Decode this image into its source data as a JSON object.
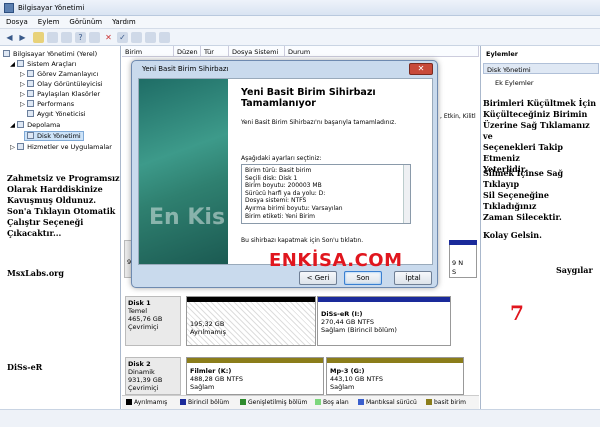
{
  "window": {
    "title": "Bilgisayar Yönetimi"
  },
  "menu": [
    "Dosya",
    "Eylem",
    "Görünüm",
    "Yardım"
  ],
  "tree": {
    "root": "Bilgisayar Yönetimi (Yerel)",
    "items": [
      "Sistem Araçları",
      "Görev Zamanlayıcı",
      "Olay Görüntüleyicisi",
      "Paylaşılan Klasörler",
      "Performans",
      "Aygıt Yöneticisi",
      "Depolama",
      "Disk Yönetimi",
      "Hizmetler ve Uygulamalar"
    ]
  },
  "columns": [
    "Birim",
    "Düzen",
    "Tür",
    "Dosya Sistemi",
    "Durum"
  ],
  "actions": {
    "header": "Eylemler",
    "selected": "Disk Yönetimi",
    "more": "Ek Eylemler"
  },
  "wizard": {
    "window_title": "Yeni Basit Birim Sihirbazı",
    "heading_line1": "Yeni Basit Birim Sihirbazı",
    "heading_line2": "Tamamlanıyor",
    "success_text": "Yeni Basit Birim Sihirbazı'nı başarıyla tamamladınız.",
    "settings_label": "Aşağıdaki ayarları seçtiniz:",
    "settings": [
      "Birim türü: Basit birim",
      "Seçili disk: Disk 1",
      "Birim boyutu: 200003 MB",
      "Sürücü harfi ya da yolu: D:",
      "Dosya sistemi: NTFS",
      "Ayırma birimi boyutu: Varsayılan",
      "Birim etiketi: Yeni Birim"
    ],
    "close_text": "Bu sihirbazı kapatmak için Son'u tıklatın.",
    "btn_back": "< Geri",
    "btn_finish": "Son",
    "btn_cancel": "İptal",
    "side_watermark": "En Kis"
  },
  "partial_text": {
    "etkin": ", Etkin, Kilitl"
  },
  "disks": [
    {
      "name": "Disk 1",
      "type": "Temel",
      "size": "465,76 GB",
      "state": "Çevrimiçi",
      "parts": [
        {
          "size": "195,32 GB",
          "state": "Ayrılmamış"
        },
        {
          "label": "DiSs-eR  (I:)",
          "size": "270,44 GB NTFS",
          "state": "Sağlam (Birincil bölüm)"
        }
      ]
    },
    {
      "name": "Disk 2",
      "type": "Dinamik",
      "size": "931,39 GB",
      "state": "Çevrimiçi",
      "parts": [
        {
          "label": "Filmler  (K:)",
          "size": "488,28 GB NTFS",
          "state": "Sağlam"
        },
        {
          "label": "Mp-3  (G:)",
          "size": "443,10 GB NTFS",
          "state": "Sağlam"
        }
      ]
    }
  ],
  "hidden_row": {
    "left": "9",
    "right_top": "9 N",
    "right_bottom": "S"
  },
  "legend": [
    "Ayrılmamış",
    "Birincil bölüm",
    "Genişletilmiş bölüm",
    "Boş alan",
    "Mantıksal sürücü",
    "basit birim"
  ],
  "colors": {
    "unallocated": "#000000",
    "primary": "#1a2a9a",
    "extended": "#2e8b2e",
    "free": "#7cd67c",
    "logical": "#3a5fcd",
    "simple": "#8b7d1a",
    "overlay_red": "#e0161e"
  },
  "overlays": {
    "left_paragraph": [
      "Zahmetsiz ve Programsız",
      "Olarak Harddiskinize",
      "Kavuşmuş Oldunuz.",
      "Son'a Tıklayın Otomatik",
      "Çalıştır Seçeneği",
      "Çıkacaktır..."
    ],
    "site": "MsxLabs.org",
    "author": "DiSs-eR",
    "right_paragraph1": [
      "Birimleri Küçültmek İçin",
      "Küçülteceğiniz Birimin",
      "Üzerine Sağ Tıklamanız ve",
      "Seçenekleri Takip Etmeniz",
      "Yeterlidir."
    ],
    "right_paragraph2": [
      "Silmek İçinse Sağ Tıklayıp",
      "Sil Seçeneğine Tıkladığınız",
      "Zaman Silecektir."
    ],
    "good_luck": "Kolay Gelsin.",
    "regards": "Saygılar",
    "brand": "ENKİSA.COM",
    "step": "7"
  }
}
